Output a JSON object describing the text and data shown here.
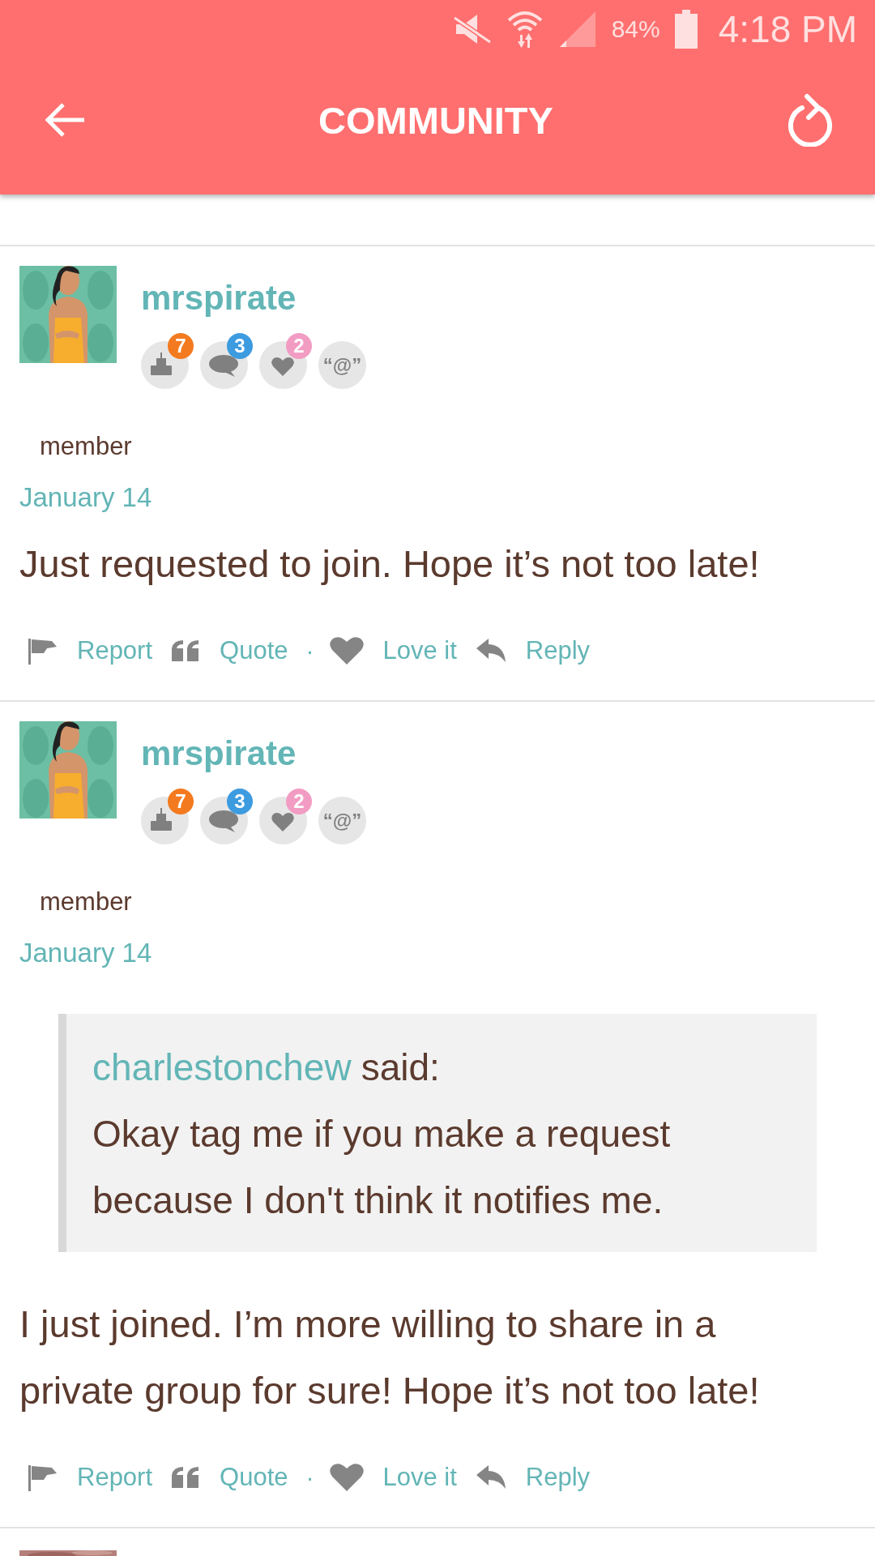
{
  "status_bar": {
    "battery": "84%",
    "time": "4:18 PM"
  },
  "app_bar": {
    "title": "COMMUNITY"
  },
  "posts": [
    {
      "username": "mrspirate",
      "badges": [
        {
          "kind": "cake",
          "count": "7",
          "color": "#f47a1f"
        },
        {
          "kind": "comment",
          "count": "3",
          "color": "#3d9be0"
        },
        {
          "kind": "heart",
          "count": "2",
          "color": "#f29cc3"
        },
        {
          "kind": "mention",
          "label": "“@”"
        }
      ],
      "role": "member",
      "date": "January 14",
      "body": [
        "Just requested to join. Hope it’s not too late!"
      ],
      "actions": [
        {
          "kind": "report",
          "label": "Report"
        },
        {
          "kind": "quote",
          "label": "Quote"
        },
        {
          "kind": "separator",
          "label": "·"
        },
        {
          "kind": "love",
          "label": "Love it"
        },
        {
          "kind": "reply",
          "label": "Reply"
        }
      ]
    },
    {
      "username": "mrspirate",
      "badges": [
        {
          "kind": "cake",
          "count": "7",
          "color": "#f47a1f"
        },
        {
          "kind": "comment",
          "count": "3",
          "color": "#3d9be0"
        },
        {
          "kind": "heart",
          "count": "2",
          "color": "#f29cc3"
        },
        {
          "kind": "mention",
          "label": "“@”"
        }
      ],
      "role": "member",
      "date": "January 14",
      "quote": {
        "author": "charlestonchew",
        "said": "said:",
        "lines": [
          "Okay tag me if you make a request",
          "because I don't think it notifies me."
        ]
      },
      "body": [
        "I just joined. I’m more willing to share in a",
        "private group for sure! Hope it’s not too late!"
      ],
      "actions": [
        {
          "kind": "report",
          "label": "Report"
        },
        {
          "kind": "quote",
          "label": "Quote"
        },
        {
          "kind": "separator",
          "label": "·"
        },
        {
          "kind": "love",
          "label": "Love it"
        },
        {
          "kind": "reply",
          "label": "Reply"
        }
      ]
    }
  ]
}
